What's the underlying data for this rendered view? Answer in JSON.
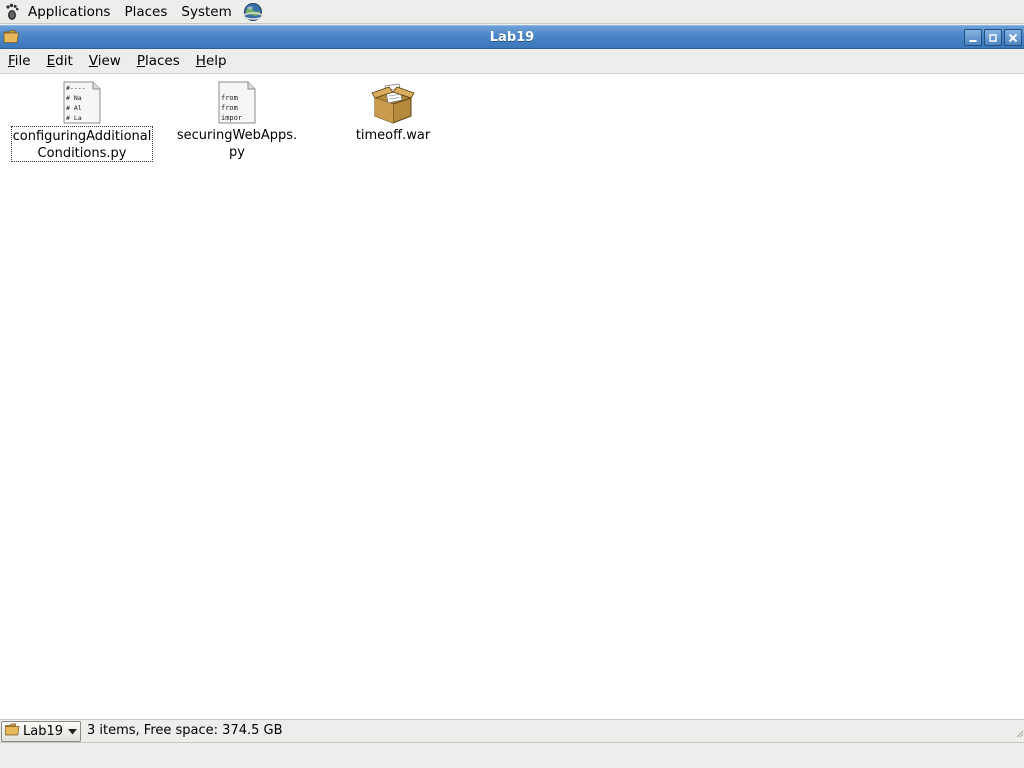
{
  "top_panel": {
    "menus": [
      "Applications",
      "Places",
      "System"
    ],
    "icons": {
      "foot": "gnome-foot-icon",
      "network": "network-globe-icon"
    }
  },
  "window": {
    "title": "Lab19",
    "title_icon": "folder-icon",
    "controls": [
      "minimize-icon",
      "maximize-icon",
      "close-icon"
    ]
  },
  "menubar": {
    "items": [
      {
        "label": "File",
        "mnemonic": "F",
        "rest": "ile"
      },
      {
        "label": "Edit",
        "mnemonic": "E",
        "rest": "dit"
      },
      {
        "label": "View",
        "mnemonic": "V",
        "rest": "iew"
      },
      {
        "label": "Places",
        "mnemonic": "P",
        "rest": "laces"
      },
      {
        "label": "Help",
        "mnemonic": "H",
        "rest": "elp"
      }
    ]
  },
  "files": [
    {
      "name_line1": "configuringAdditional",
      "name_line2": "Conditions.py",
      "icon": "python-script-icon",
      "selected": true,
      "preview": [
        "#----",
        "#  Na",
        "#  Al",
        "#  La"
      ]
    },
    {
      "name_line1": "securingWebApps.",
      "name_line2": "py",
      "icon": "python-script-icon",
      "selected": false,
      "preview": [
        "from",
        "from",
        "impor"
      ]
    },
    {
      "name_line1": "timeoff.war",
      "name_line2": "",
      "icon": "archive-package-icon",
      "selected": false
    }
  ],
  "statusbar": {
    "location_label": "Lab19",
    "status_text": "3 items, Free space: 374.5 GB"
  },
  "colors": {
    "titlebar": "#4a86c8",
    "panel_bg": "#ededeb",
    "content_bg": "#ffffff"
  }
}
